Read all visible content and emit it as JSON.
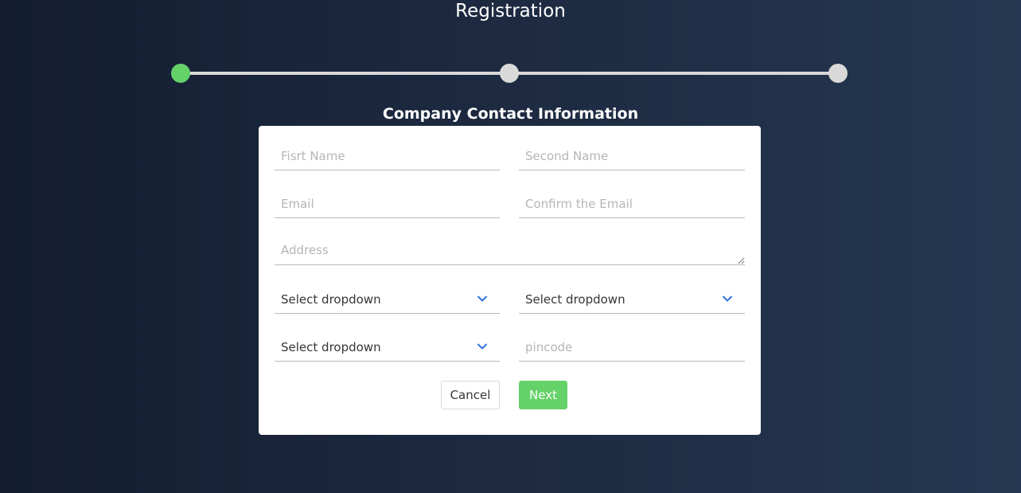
{
  "header": {
    "title": "Registration"
  },
  "stepper": {
    "steps": [
      {
        "state": "active",
        "color": "#65d269"
      },
      {
        "state": "pending",
        "color": "#d9d9d9"
      },
      {
        "state": "pending",
        "color": "#d9d9d9"
      }
    ]
  },
  "form": {
    "section_title": "Company Contact Information",
    "first_name": {
      "placeholder": "Fisrt Name",
      "value": ""
    },
    "second_name": {
      "placeholder": "Second Name",
      "value": ""
    },
    "email": {
      "placeholder": "Email",
      "value": ""
    },
    "confirm_email": {
      "placeholder": "Confirm the Email",
      "value": ""
    },
    "address": {
      "placeholder": "Address",
      "value": ""
    },
    "dropdowns": [
      {
        "selected": "Select dropdown",
        "icon": "chevron-down-icon"
      },
      {
        "selected": "Select dropdown",
        "icon": "chevron-down-icon"
      },
      {
        "selected": "Select dropdown",
        "icon": "chevron-down-icon"
      }
    ],
    "pincode": {
      "placeholder": "pincode",
      "value": ""
    },
    "cancel_label": "Cancel",
    "next_label": "Next"
  },
  "colors": {
    "accent": "#65d269",
    "chevron": "#3273dc",
    "background_dark": "#141d31",
    "background_light": "#253851"
  }
}
